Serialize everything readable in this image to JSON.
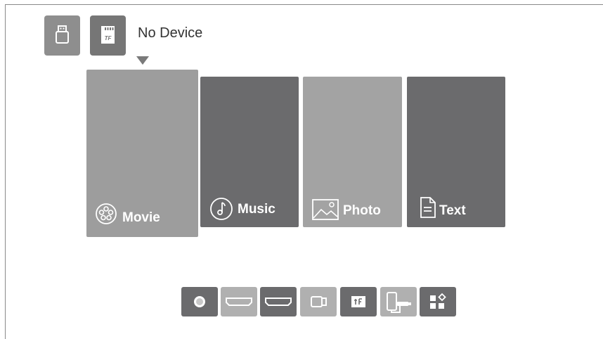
{
  "device_bar": {
    "usb_icon": "usb-drive-icon",
    "tf_icon": "tf-card-icon",
    "tf_card_text": "TF",
    "status": "No Device"
  },
  "media_tiles": [
    {
      "id": "movie",
      "label": "Movie",
      "icon": "film-reel-icon",
      "selected": true
    },
    {
      "id": "music",
      "label": "Music",
      "icon": "music-note-icon",
      "selected": false
    },
    {
      "id": "photo",
      "label": "Photo",
      "icon": "picture-icon",
      "selected": false
    },
    {
      "id": "text",
      "label": "Text",
      "icon": "document-icon",
      "selected": false
    }
  ],
  "source_bar": [
    {
      "icon": "media-source-icon"
    },
    {
      "icon": "hdmi-1-icon"
    },
    {
      "icon": "hdmi-2-icon"
    },
    {
      "icon": "usb-source-icon"
    },
    {
      "icon": "tf-source-icon"
    },
    {
      "icon": "phone-mirror-icon"
    },
    {
      "icon": "apps-icon"
    }
  ],
  "colors": {
    "selected_tile": "#9d9d9d",
    "dark_tile": "#6b6b6d",
    "light_tile": "#a3a3a3",
    "label": "#ffffff"
  }
}
